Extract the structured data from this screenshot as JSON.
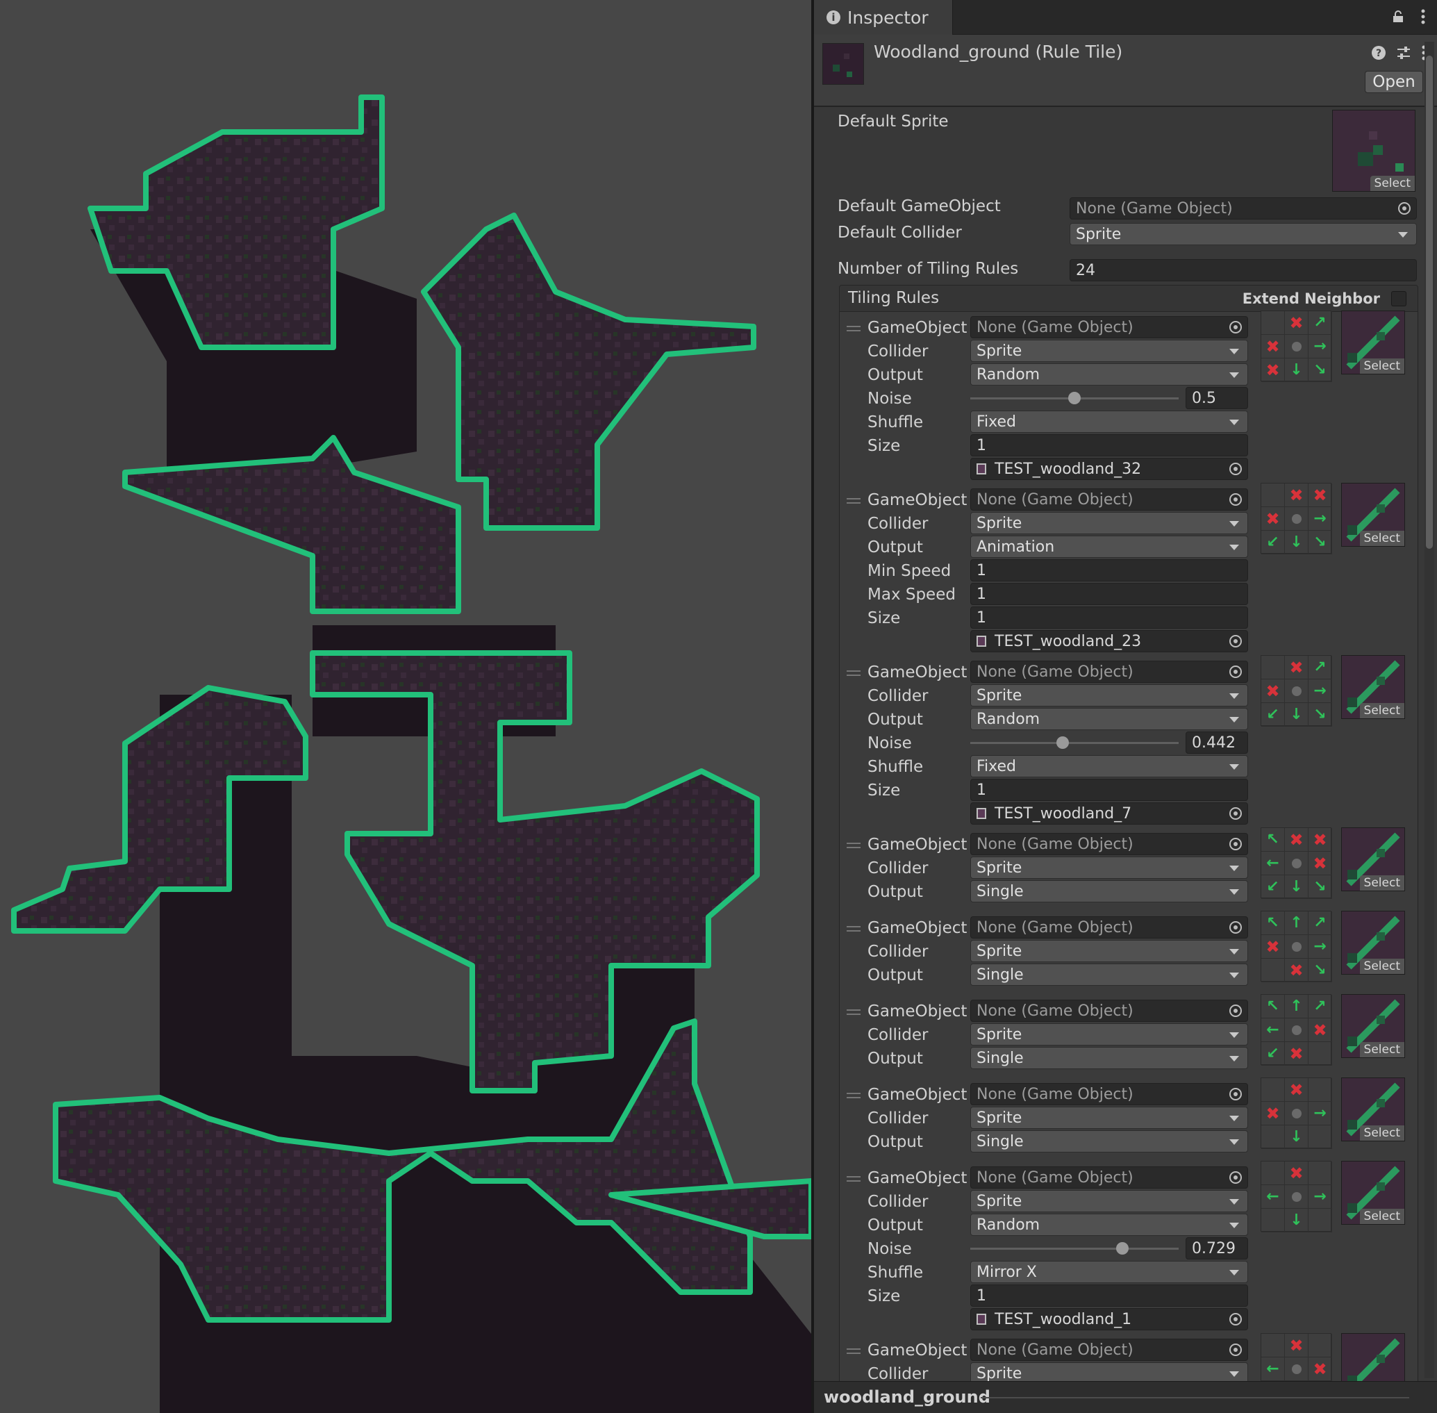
{
  "tab": {
    "title": "Inspector"
  },
  "asset": {
    "title": "Woodland_ground (Rule Tile)",
    "open_label": "Open"
  },
  "props": {
    "default_sprite_label": "Default Sprite",
    "select_label": "Select",
    "default_gameobject_label": "Default GameObject",
    "default_gameobject_value": "None (Game Object)",
    "default_collider_label": "Default Collider",
    "default_collider_value": "Sprite",
    "num_rules_label": "Number of Tiling Rules",
    "num_rules_value": "24"
  },
  "rules_panel": {
    "title": "Tiling Rules",
    "extend_label": "Extend Neighbor"
  },
  "labels": {
    "gameobject": "GameObject",
    "collider": "Collider",
    "output": "Output",
    "noise": "Noise",
    "shuffle": "Shuffle",
    "size": "Size",
    "min_speed": "Min Speed",
    "max_speed": "Max Speed",
    "none_go": "None (Game Object)",
    "select": "Select"
  },
  "rules": [
    {
      "collider": "Sprite",
      "output": "Random",
      "noise": "0.5",
      "noise_frac": 0.5,
      "shuffle": "Fixed",
      "size": "1",
      "sprite": "TEST_woodland_32",
      "grid": [
        "",
        "x",
        "ne",
        "x",
        "c",
        "e",
        "x",
        "s",
        "se"
      ]
    },
    {
      "collider": "Sprite",
      "output": "Animation",
      "min_speed": "1",
      "max_speed": "1",
      "size": "1",
      "sprite": "TEST_woodland_23",
      "grid": [
        "",
        "x",
        "x",
        "x",
        "c",
        "e",
        "sw",
        "s",
        "se"
      ]
    },
    {
      "collider": "Sprite",
      "output": "Random",
      "noise": "0.442",
      "noise_frac": 0.442,
      "shuffle": "Fixed",
      "size": "1",
      "sprite": "TEST_woodland_7",
      "grid": [
        "",
        "x",
        "ne",
        "x",
        "c",
        "e",
        "sw",
        "s",
        "se"
      ]
    },
    {
      "collider": "Sprite",
      "output": "Single",
      "grid": [
        "nw",
        "x",
        "x",
        "w",
        "c",
        "x",
        "sw",
        "s",
        "se"
      ]
    },
    {
      "collider": "Sprite",
      "output": "Single",
      "grid": [
        "nw",
        "n",
        "ne",
        "x",
        "c",
        "e",
        "",
        "x",
        "se"
      ]
    },
    {
      "collider": "Sprite",
      "output": "Single",
      "grid": [
        "nw",
        "n",
        "ne",
        "w",
        "c",
        "x",
        "sw",
        "x",
        ""
      ]
    },
    {
      "collider": "Sprite",
      "output": "Single",
      "grid": [
        "",
        "x",
        "",
        "x",
        "c",
        "e",
        "",
        "s",
        ""
      ]
    },
    {
      "collider": "Sprite",
      "output": "Random",
      "noise": "0.729",
      "noise_frac": 0.729,
      "shuffle": "Mirror X",
      "size": "1",
      "sprite": "TEST_woodland_1",
      "grid": [
        "",
        "x",
        "",
        "w",
        "c",
        "e",
        "",
        "s",
        ""
      ]
    },
    {
      "collider": "Sprite",
      "output": "",
      "grid": [
        "",
        "x",
        "",
        "w",
        "c",
        "x",
        "",
        "",
        ""
      ]
    }
  ],
  "footer": {
    "name": "woodland_ground"
  },
  "colors": {
    "accent_green": "#2fc25a",
    "deny_red": "#d8323a",
    "ground_dark": "#1e161e",
    "ground_purple": "#2f2230",
    "edge_green": "#2fd080"
  }
}
